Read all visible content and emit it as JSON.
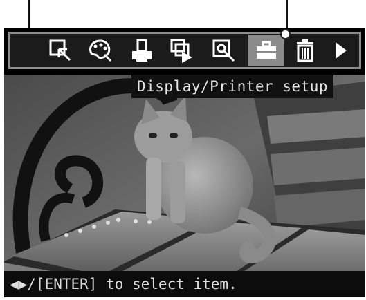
{
  "menu": {
    "items": [
      {
        "icon": "select-image-icon",
        "selected": false
      },
      {
        "icon": "palette-edit-icon",
        "selected": false
      },
      {
        "icon": "print-icon",
        "selected": false
      },
      {
        "icon": "slideshow-icon",
        "selected": false
      },
      {
        "icon": "search-icon",
        "selected": false
      },
      {
        "icon": "toolbox-icon",
        "selected": true
      },
      {
        "icon": "trash-icon",
        "selected": false
      },
      {
        "icon": "right-arrow-icon",
        "selected": false
      }
    ]
  },
  "tooltip": {
    "text": "Display/Printer setup"
  },
  "status": {
    "text": "◀▶/[ENTER] to select item."
  },
  "colors": {
    "background": "#000000",
    "menu_frame": "#8c8c8c",
    "selected_bg": "#8b8b8b",
    "text": "#e6e6e6"
  }
}
